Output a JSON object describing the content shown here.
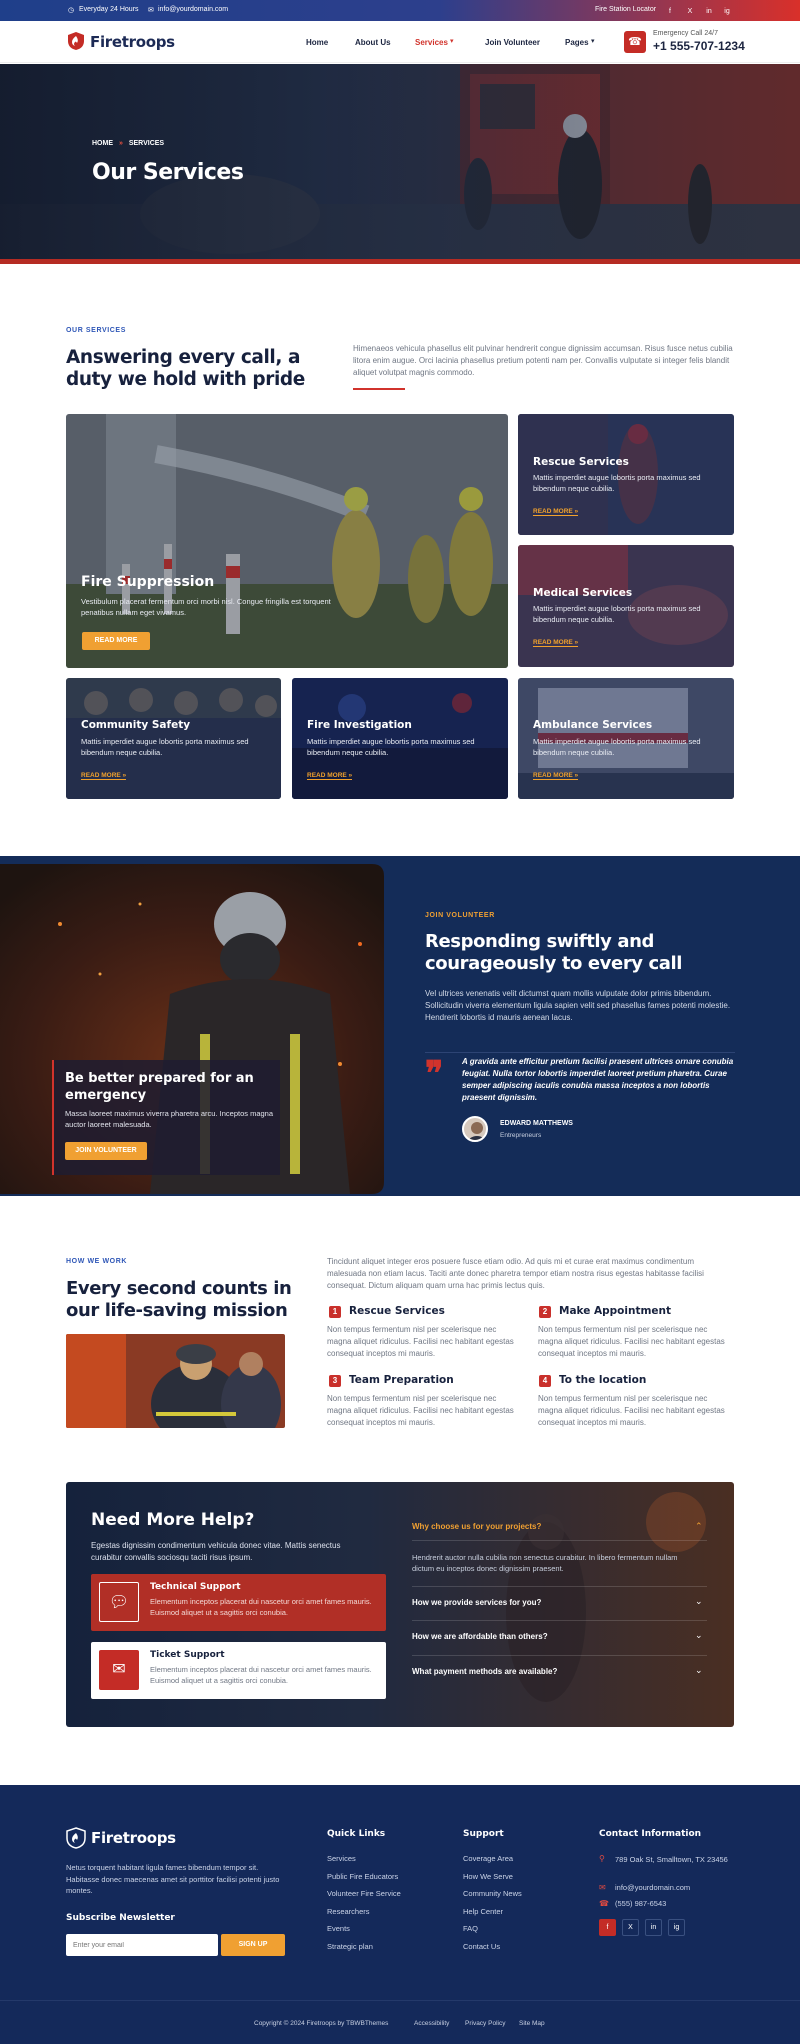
{
  "topbar": {
    "hours": "Everyday 24 Hours",
    "email": "info@yourdomain.com",
    "locator": "Fire Station Locator",
    "socials": [
      "f",
      "X",
      "in",
      "ig"
    ]
  },
  "nav": {
    "logo": "Firetroops",
    "menu": [
      "Home",
      "About Us",
      "Services",
      "Join Volunteer",
      "Pages"
    ],
    "emergency_label": "Emergency Call 24/7",
    "emergency_phone": "+1 555-707-1234"
  },
  "hero": {
    "crumb_home": "HOME",
    "crumb_sep": "»",
    "crumb_current": "SERVICES",
    "title": "Our Services"
  },
  "services": {
    "eyebrow": "OUR SERVICES",
    "heading": "Answering every call, a duty we hold with pride",
    "intro": "Himenaeos vehicula phasellus elit pulvinar hendrerit congue dignissim accumsan. Risus fusce netus cubilia litora enim augue. Orci lacinia phasellus pretium potenti nam per. Convallis vulputate si integer felis blandit aliquet volutpat magnis commodo.",
    "feature": {
      "title": "Fire Suppression",
      "desc": "Vestibulum placerat fermentum orci morbi nisl. Congue fringilla est torquent penatibus nullam eget vivamus.",
      "btn": "READ MORE"
    },
    "cards": [
      {
        "title": "Rescue Services",
        "desc": "Mattis imperdiet augue lobortis porta maximus sed bibendum neque cubilia.",
        "link": "READ MORE »"
      },
      {
        "title": "Medical Services",
        "desc": "Mattis imperdiet augue lobortis porta maximus sed bibendum neque cubilia.",
        "link": "READ MORE »"
      },
      {
        "title": "Community Safety",
        "desc": "Mattis imperdiet augue lobortis porta maximus sed bibendum neque cubilia.",
        "link": "READ MORE »"
      },
      {
        "title": "Fire Investigation",
        "desc": "Mattis imperdiet augue lobortis porta maximus sed bibendum neque cubilia.",
        "link": "READ MORE »"
      },
      {
        "title": "Ambulance Services",
        "desc": "Mattis imperdiet augue lobortis porta maximus sed bibendum neque cubilia.",
        "link": "READ MORE »"
      }
    ]
  },
  "volunteer": {
    "box_title": "Be better prepared for an emergency",
    "box_desc": "Massa laoreet maximus viverra pharetra arcu. Inceptos magna auctor laoreet malesuada.",
    "box_btn": "JOIN VOLUNTEER",
    "eyebrow": "JOIN VOLUNTEER",
    "heading": "Responding swiftly and courageously to every call",
    "desc": "Vel ultrices venenatis velit dictumst quam mollis vulputate dolor primis bibendum. Sollicitudin viverra elementum ligula sapien velit sed phasellus fames potenti molestie. Hendrerit lobortis id mauris aenean lacus.",
    "quote": "A gravida ante efficitur pretium facilisi praesent ultrices ornare conubia feugiat. Nulla tortor lobortis imperdiet laoreet pretium pharetra. Curae semper adipiscing iaculis conubia massa inceptos a non lobortis praesent dignissim.",
    "author": "EDWARD MATTHEWS",
    "role": "Entrepreneurs"
  },
  "howwork": {
    "eyebrow": "HOW WE WORK",
    "heading": "Every second counts in our life-saving mission",
    "intro": "Tincidunt aliquet integer eros posuere fusce etiam odio. Ad quis mi et curae erat maximus condimentum malesuada non etiam lacus. Taciti ante donec pharetra tempor etiam nostra risus egestas habitasse facilisi consequat. Dictum aliquam quam urna hac primis lectus quis.",
    "steps": [
      {
        "num": "1",
        "title": "Rescue Services",
        "desc": "Non tempus fermentum nisl per scelerisque nec magna aliquet ridiculus. Facilisi nec habitant egestas consequat inceptos mi mauris."
      },
      {
        "num": "2",
        "title": "Make Appointment",
        "desc": "Non tempus fermentum nisl per scelerisque nec magna aliquet ridiculus. Facilisi nec habitant egestas consequat inceptos mi mauris."
      },
      {
        "num": "3",
        "title": "Team Preparation",
        "desc": "Non tempus fermentum nisl per scelerisque nec magna aliquet ridiculus. Facilisi nec habitant egestas consequat inceptos mi mauris."
      },
      {
        "num": "4",
        "title": "To the location",
        "desc": "Non tempus fermentum nisl per scelerisque nec magna aliquet ridiculus. Facilisi nec habitant egestas consequat inceptos mi mauris."
      }
    ]
  },
  "help": {
    "title": "Need More Help?",
    "desc": "Egestas dignissim condimentum vehicula donec vitae. Mattis senectus curabitur convallis sociosqu taciti risus ipsum.",
    "support": [
      {
        "title": "Technical Support",
        "desc": "Elementum inceptos placerat dui nascetur orci amet fames mauris. Euismod aliquet ut a sagittis orci conubia."
      },
      {
        "title": "Ticket Support",
        "desc": "Elementum inceptos placerat dui nascetur orci amet fames mauris. Euismod aliquet ut a sagittis orci conubia."
      }
    ],
    "faq": [
      {
        "q": "Why choose us for your projects?",
        "a": "Hendrerit auctor nulla cubilia non senectus curabitur. In libero fermentum nullam dictum eu inceptos donec dignissim praesent."
      },
      {
        "q": "How we provide services for you?"
      },
      {
        "q": "How we are affordable than others?"
      },
      {
        "q": "What payment methods are available?"
      }
    ]
  },
  "footer": {
    "logo": "Firetroops",
    "about": "Netus torquent habitant ligula fames bibendum tempor sit. Habitasse donec maecenas amet sit porttitor facilisi potenti justo montes.",
    "newsletter": "Subscribe Newsletter",
    "email_placeholder": "Enter your email",
    "signup": "SIGN UP",
    "quick_title": "Quick Links",
    "quick": [
      "Services",
      "Public Fire Educators",
      "Volunteer Fire Service",
      "Researchers",
      "Events",
      "Strategic plan"
    ],
    "support_title": "Support",
    "support": [
      "Coverage Area",
      "How We Serve",
      "Community News",
      "Help Center",
      "FAQ",
      "Contact Us"
    ],
    "contact_title": "Contact Information",
    "address": "789 Oak St, Smalltown, TX 23456",
    "email": "info@yourdomain.com",
    "phone": "(555) 987-6543",
    "socials": [
      "f",
      "X",
      "in",
      "ig"
    ],
    "copyright": "Copyright © 2024 Firetroops by TBWBThemes",
    "bottom_links": [
      "Accessibility",
      "Privacy Policy",
      "Site Map"
    ]
  }
}
